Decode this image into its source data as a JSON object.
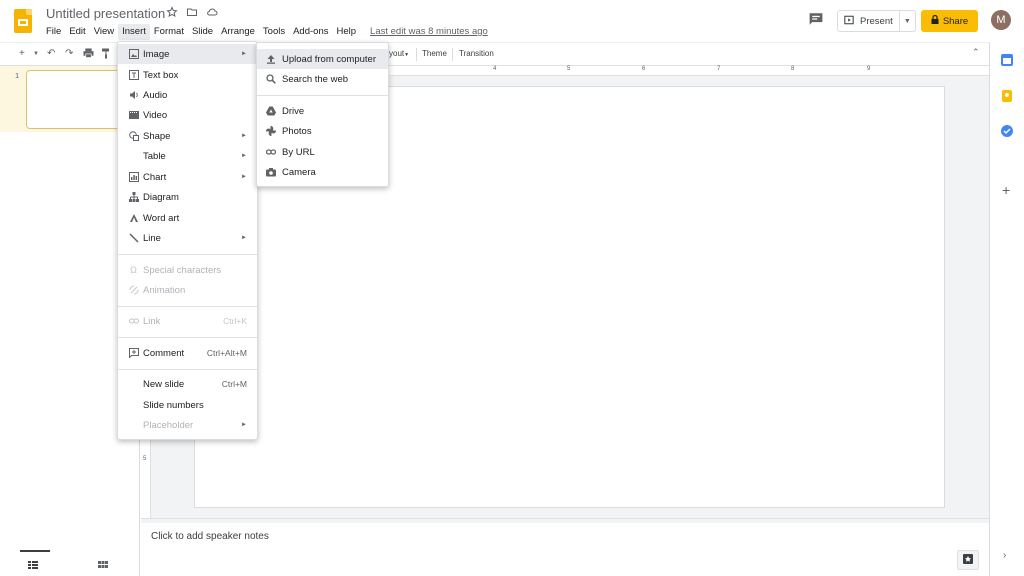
{
  "app": {
    "title": "Untitled presentation",
    "last_edit": "Last edit was 8 minutes ago",
    "menus": [
      "File",
      "Edit",
      "View",
      "Insert",
      "Format",
      "Slide",
      "Arrange",
      "Tools",
      "Add-ons",
      "Help"
    ],
    "active_menu": "Insert"
  },
  "header": {
    "present_label": "Present",
    "share_label": "Share",
    "avatar_initial": "M"
  },
  "toolbar": {
    "layout_label": "yout",
    "theme_label": "Theme",
    "transition_label": "Transition"
  },
  "ruler": {
    "top_numbers": [
      "4",
      "5",
      "6",
      "7",
      "8",
      "9"
    ],
    "left_number": "5"
  },
  "filmstrip": {
    "slide_number": "1"
  },
  "notes": {
    "placeholder": "Click to add speaker notes"
  },
  "insert_menu": {
    "items": [
      {
        "label": "Image",
        "icon": "image-icon",
        "submenu": true,
        "highlighted": true
      },
      {
        "label": "Text box",
        "icon": "text-box-icon"
      },
      {
        "label": "Audio",
        "icon": "audio-icon"
      },
      {
        "label": "Video",
        "icon": "video-icon"
      },
      {
        "label": "Shape",
        "icon": "shape-icon",
        "submenu": true
      },
      {
        "label": "Table",
        "submenu": true
      },
      {
        "label": "Chart",
        "icon": "chart-icon",
        "submenu": true
      },
      {
        "label": "Diagram",
        "icon": "diagram-icon"
      },
      {
        "label": "Word art",
        "icon": "word-art-icon"
      },
      {
        "label": "Line",
        "icon": "line-icon",
        "submenu": true
      },
      {
        "label": "Special characters",
        "icon": "special-characters-icon",
        "disabled": true
      },
      {
        "label": "Animation",
        "icon": "animation-icon",
        "disabled": true
      },
      {
        "label": "Link",
        "icon": "link-icon",
        "shortcut": "Ctrl+K",
        "disabled": true
      },
      {
        "label": "Comment",
        "icon": "comment-icon",
        "shortcut": "Ctrl+Alt+M"
      },
      {
        "label": "New slide",
        "shortcut": "Ctrl+M"
      },
      {
        "label": "Slide numbers"
      },
      {
        "label": "Placeholder",
        "submenu": true,
        "disabled": true
      }
    ]
  },
  "image_submenu": {
    "items": [
      {
        "label": "Upload from computer",
        "icon": "upload-icon"
      },
      {
        "label": "Search the web",
        "icon": "search-icon"
      },
      {
        "label": "Drive",
        "icon": "drive-icon"
      },
      {
        "label": "Photos",
        "icon": "photos-icon"
      },
      {
        "label": "By URL",
        "icon": "link-icon"
      },
      {
        "label": "Camera",
        "icon": "camera-icon"
      }
    ]
  },
  "colors": {
    "accent": "#fbbc04",
    "logo": "#f4b400",
    "selected_slide_bg": "#fef7e0"
  }
}
